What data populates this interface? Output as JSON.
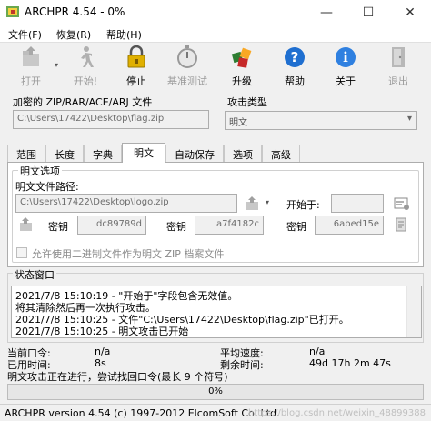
{
  "window": {
    "title": "ARCHPR 4.54 - 0%",
    "minimize": "—",
    "maximize": "☐",
    "close": "✕"
  },
  "menu": {
    "file": "文件(F)",
    "recover": "恢复(R)",
    "help": "帮助(H)"
  },
  "toolbar": {
    "open": "打开",
    "start": "开始!",
    "stop": "停止",
    "benchmark": "基准测试",
    "upgrade": "升级",
    "help": "帮助",
    "about": "关于",
    "exit": "退出",
    "arrow": "▾"
  },
  "archive": {
    "label": "加密的 ZIP/RAR/ACE/ARJ 文件",
    "path": "C:\\Users\\17422\\Desktop\\flag.zip"
  },
  "attack": {
    "label": "攻击类型",
    "value": "明文",
    "dropdown_arrow": "▾"
  },
  "tabs": [
    "范围",
    "长度",
    "字典",
    "明文",
    "自动保存",
    "选项",
    "高级"
  ],
  "plaintext": {
    "group_title": "明文选项",
    "path_label": "明文文件路径:",
    "path": "C:\\Users\\17422\\Desktop\\logo.zip",
    "start_label": "开始于:",
    "start_value": "",
    "key_label": "密钥",
    "keys": [
      "dc89789d",
      "a7f4182c",
      "6abed15e"
    ],
    "checkbox_label": "允许使用二进制文件作为明文 ZIP 档案文件"
  },
  "status": {
    "group_title": "状态窗口",
    "log": [
      "2021/7/8 15:10:19 - \"开始于\"字段包含无效值。",
      "将其清除然后再一次执行攻击。",
      "2021/7/8 15:10:25 - 文件\"C:\\Users\\17422\\Desktop\\flag.zip\"已打开。",
      "2021/7/8 15:10:25 - 明文攻击已开始"
    ]
  },
  "stats": {
    "current_label": "当前口令:",
    "current_value": "n/a",
    "elapsed_label": "已用时间:",
    "elapsed_value": "8s",
    "speed_label": "平均速度:",
    "speed_value": "n/a",
    "remaining_label": "剩余时间:",
    "remaining_value": "49d 17h 2m 47s",
    "message": "明文攻击正在进行，尝试找回口令(最长 9 个符号)"
  },
  "progress": {
    "value": 0,
    "text": "0%"
  },
  "statusbar": {
    "text": "ARCHPR version 4.54 (c) 1997-2012 ElcomSoft Co. Ltd.",
    "watermark": "https://blog.csdn.net/weixin_48899388"
  },
  "colors": {
    "progress": "#06b025",
    "help_icon": "#1f6fd0",
    "stop_icon": "#e0b000"
  }
}
